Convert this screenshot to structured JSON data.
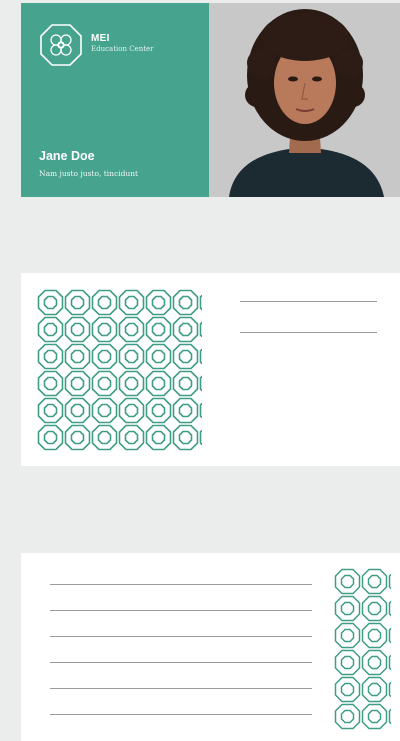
{
  "brand": {
    "name": "MEI",
    "subtitle": "Education Center",
    "accent_color": "#45a38e",
    "pattern_color": "#3f9c87"
  },
  "badge": {
    "person_name": "Jane Doe",
    "person_role": "Nam justo justo, tincidunt",
    "photo": "portrait-photo"
  },
  "card2": {
    "pattern": "octagon-lattice",
    "line_count": 2
  },
  "card3": {
    "pattern": "octagon-lattice",
    "line_count": 6
  }
}
